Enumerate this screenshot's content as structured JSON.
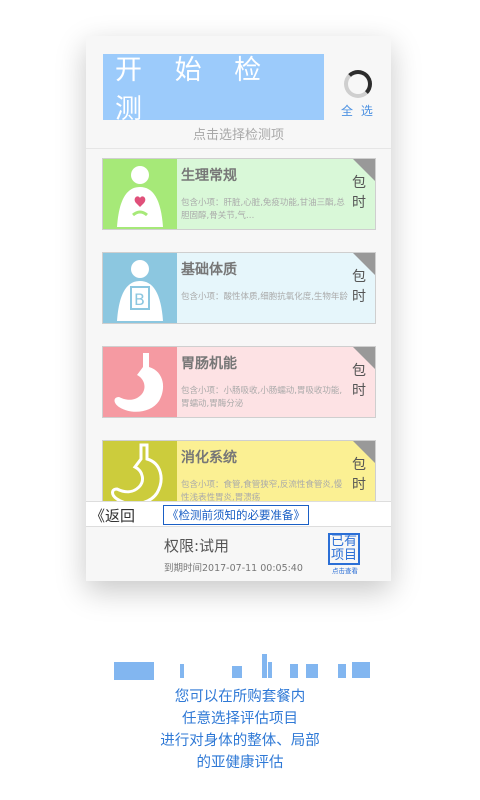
{
  "header": {
    "start_label": "开 始 检 测",
    "select_all_label": "全 选",
    "hint": "点击选择检测项"
  },
  "cards": [
    {
      "title": "生理常规",
      "desc": "包含小项：肝脏,心脏,免疫功能,甘油三酯,总胆固醇,骨关节,气…",
      "tag": "包时",
      "icon_color": "#a6e978",
      "body_color": "#d9f8d8",
      "icon_name": "body-heart-icon"
    },
    {
      "title": "基础体质",
      "desc": "包含小项：酸性体质,细胞抗氧化度,生物年龄",
      "tag": "包时",
      "icon_color": "#8cc7e0",
      "body_color": "#e6f6fb",
      "icon_name": "body-b-icon"
    },
    {
      "title": "胃肠机能",
      "desc": "包含小项：小肠吸收,小肠蠕动,胃吸收功能,胃蠕动,胃酶分泌",
      "tag": "包时",
      "icon_color": "#f59aa2",
      "body_color": "#fde2e4",
      "icon_name": "stomach-icon"
    },
    {
      "title": "消化系统",
      "desc": "包含小项：食管,食管狭窄,反流性食管炎,慢性浅表性胃炎,胃溃疡",
      "tag": "包时",
      "icon_color": "#cccc3c",
      "body_color": "#fbf093",
      "icon_name": "digestive-icon"
    }
  ],
  "nav": {
    "back_label": "《返回",
    "notice_label": "《检测前须知的必要准备》"
  },
  "account": {
    "permission": "权限:试用",
    "expire": "到期时间2017-07-11 00:05:40",
    "owned_label": "已有项目",
    "owned_sub": "点击查看"
  },
  "promo": {
    "line1": "您可以在所购套餐内",
    "line2": "任意选择评估项目",
    "line3": "进行对身体的整体、局部",
    "line4": "的亚健康评估"
  }
}
